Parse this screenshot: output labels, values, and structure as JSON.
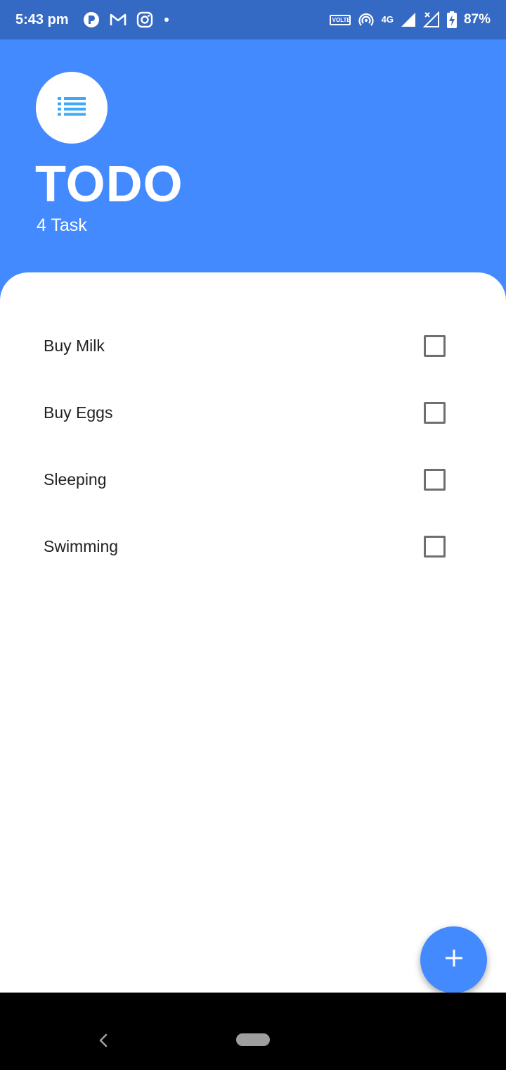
{
  "status_bar": {
    "time": "5:43 pm",
    "volte_top": "VOLTE",
    "network": "4G",
    "battery": "87%",
    "icons": [
      "app-icon",
      "gmail-icon",
      "instagram-icon",
      "dot-icon",
      "volte-icon",
      "hotspot-icon",
      "4g-icon",
      "signal-icon",
      "signal-off-icon",
      "battery-charging-icon"
    ]
  },
  "header": {
    "icon": "list-icon",
    "title": "TODO",
    "task_count": "4 Task"
  },
  "tasks": [
    {
      "label": "Buy Milk",
      "checked": false
    },
    {
      "label": "Buy Eggs",
      "checked": false
    },
    {
      "label": "Sleeping",
      "checked": false
    },
    {
      "label": "Swimming",
      "checked": false
    }
  ],
  "fab": {
    "icon": "plus-icon"
  },
  "colors": {
    "primary": "#448AFF",
    "status_bar": "#3469C4",
    "list_icon": "#3FA9F5",
    "checkbox_border": "#6F6F6F",
    "nav_bar": "#000000"
  }
}
